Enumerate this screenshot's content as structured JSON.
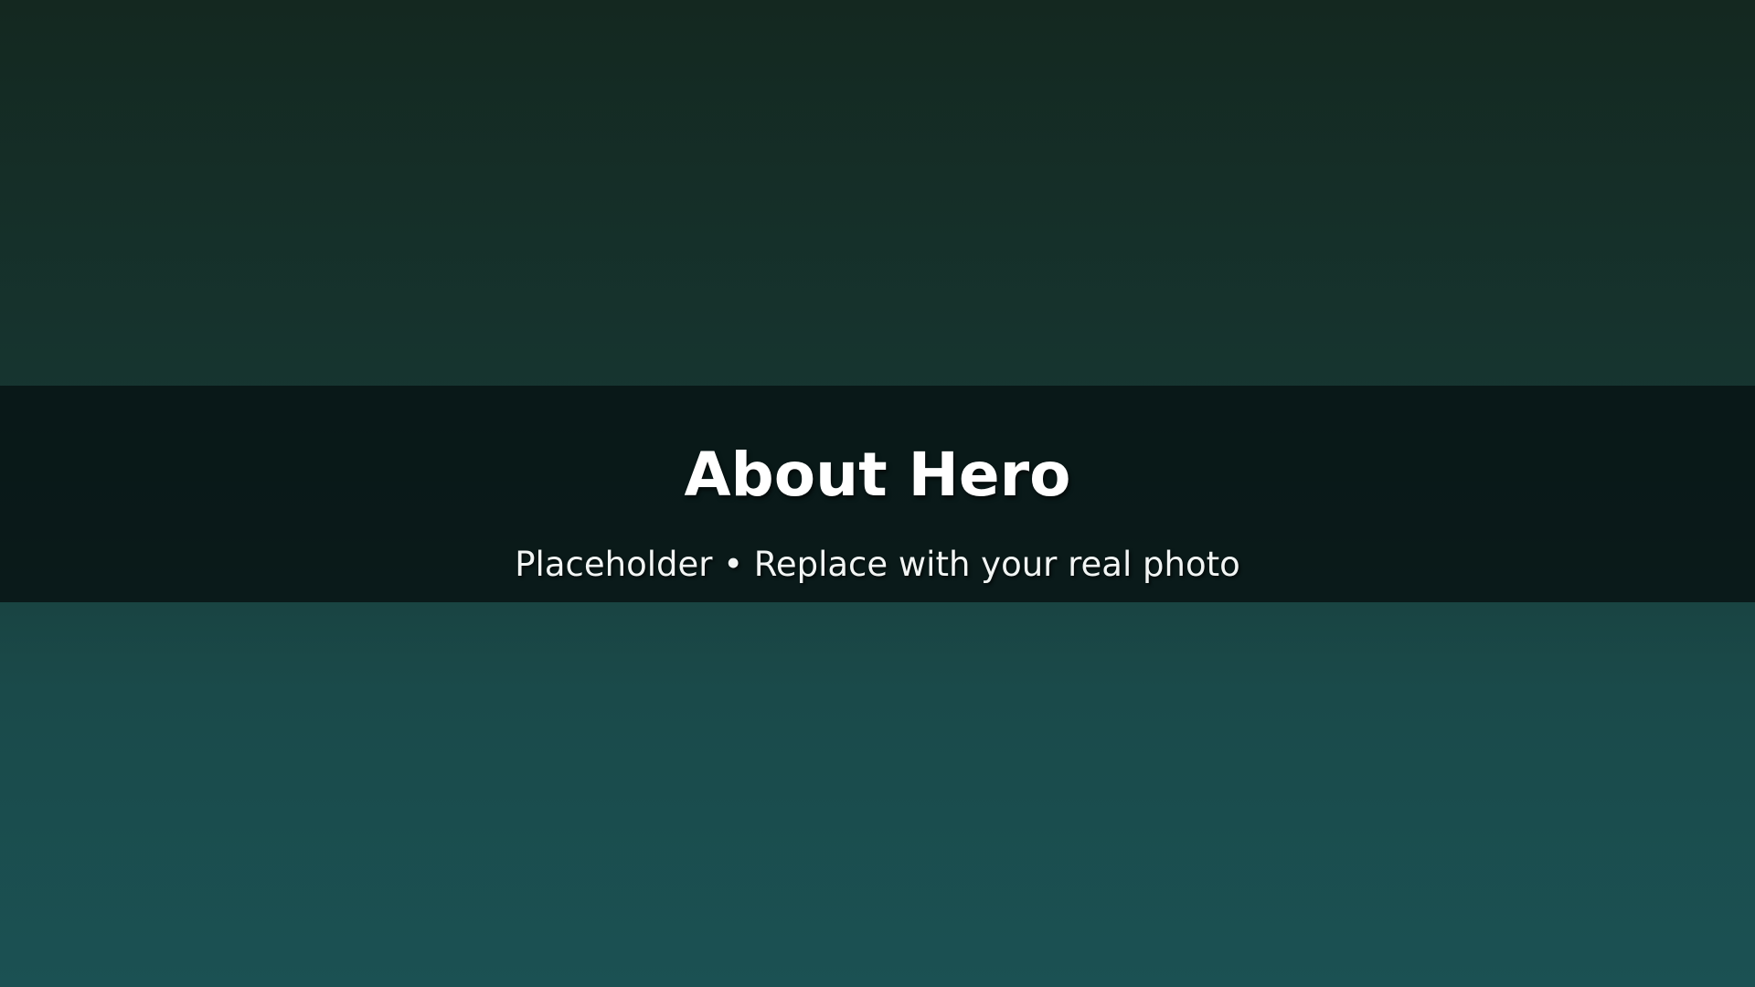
{
  "hero": {
    "title": "About Hero",
    "subtitle": "Placeholder • Replace with your real photo"
  },
  "colors": {
    "gradient_top": "#142820",
    "gradient_bottom": "#1b5153",
    "band": "#0a1a1a",
    "text": "#ffffff"
  }
}
